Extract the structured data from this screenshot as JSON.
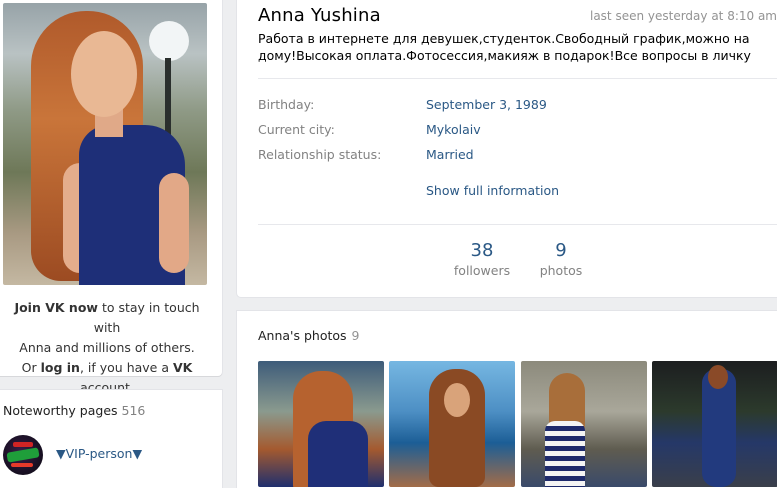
{
  "profile": {
    "name": "Anna Yushina",
    "last_seen": "last seen yesterday at 8:10 am",
    "status": "Работа в интернете для девушек,студенток.Свободный график,можно на дому!Высокая оплата.Фотосессия,макияж в подарок!Все вопросы в личку"
  },
  "info": {
    "birthday_label": "Birthday:",
    "birthday_value": "September 3, 1989",
    "city_label": "Current city:",
    "city_value": "Mykolaiv",
    "relationship_label": "Relationship status:",
    "relationship_value": "Married",
    "show_full": "Show full information"
  },
  "stats": {
    "followers_count": "38",
    "followers_label": "followers",
    "photos_count": "9",
    "photos_label": "photos"
  },
  "join": {
    "join_link": "Join VK now",
    "line1_rest": " to stay in touch with",
    "line2": "Anna and millions of others.",
    "or": "Or ",
    "login_link": "log in",
    "mid": ", if you have a ",
    "vk": "VK",
    "end": " account."
  },
  "noteworthy": {
    "title": "Noteworthy pages",
    "count": "516",
    "item_name": "▼VIP-person▼"
  },
  "photos": {
    "title": "Anna's photos",
    "count": "9"
  }
}
